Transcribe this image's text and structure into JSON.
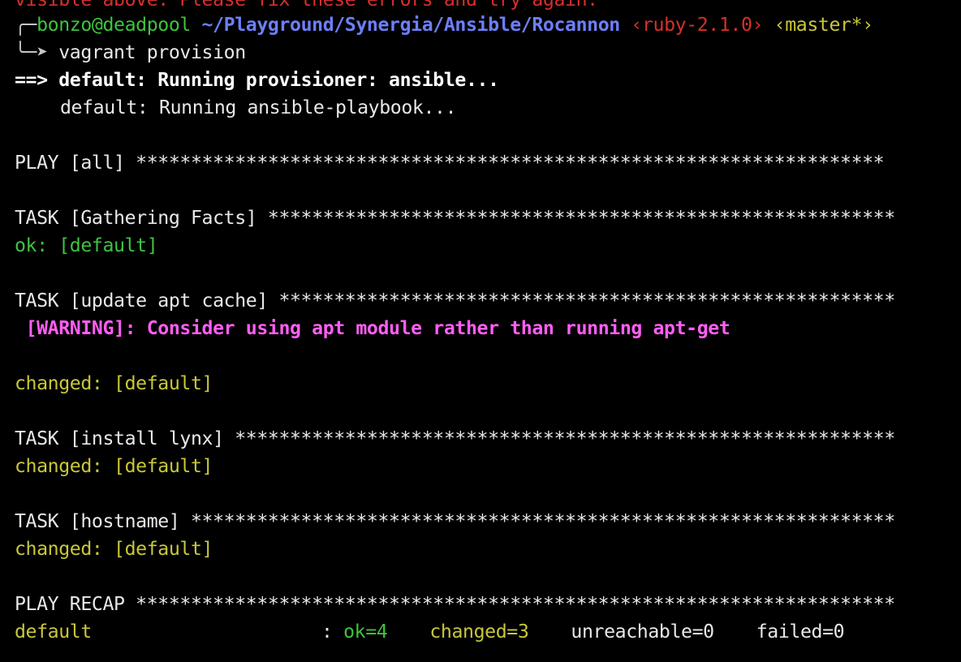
{
  "terminal": {
    "overflow_line": "visible above. Please fix these errors and try again.",
    "prompt": {
      "corner_glyph": "╭─",
      "user_host": "bonzo@deadpool",
      "path": "~/Playground/Synergia/Ansible/Rocannon",
      "ruby": "‹ruby-2.1.0›",
      "branch": "‹master*›",
      "arrow_glyph": "╰─➤",
      "command": "vagrant provision"
    },
    "vagrant": {
      "arrow": "==>",
      "provisioner_line": "default: Running provisioner: ansible...",
      "playbook_line": "default: Running ansible-playbook..."
    },
    "play_all": "PLAY [all] ********************************************************************",
    "task_facts": "TASK [Gathering Facts] *********************************************************",
    "ok_default": "ok: [default]",
    "task_apt": "TASK [update apt cache] ********************************************************",
    "warning_tag": "[WARNING]:",
    "warning_msg": " Consider using apt module rather than running apt-get",
    "changed_default_1": "changed: [default]",
    "task_lynx": "TASK [install lynx] ************************************************************",
    "changed_default_2": "changed: [default]",
    "task_hostname": "TASK [hostname] ****************************************************************",
    "changed_default_3": "changed: [default]",
    "play_recap": "PLAY RECAP *********************************************************************",
    "recap": {
      "host": "default",
      "colon": ": ",
      "ok": "ok=4",
      "changed": "changed=3",
      "unreachable": "unreachable=0",
      "failed": "failed=0"
    },
    "colors": {
      "background": "#000000",
      "text": "#e8e8e8",
      "ok": "#3fc33f",
      "changed": "#c9c73a",
      "warning": "#ff5ef5",
      "error": "#d5302c",
      "path": "#6d7ff8"
    }
  }
}
